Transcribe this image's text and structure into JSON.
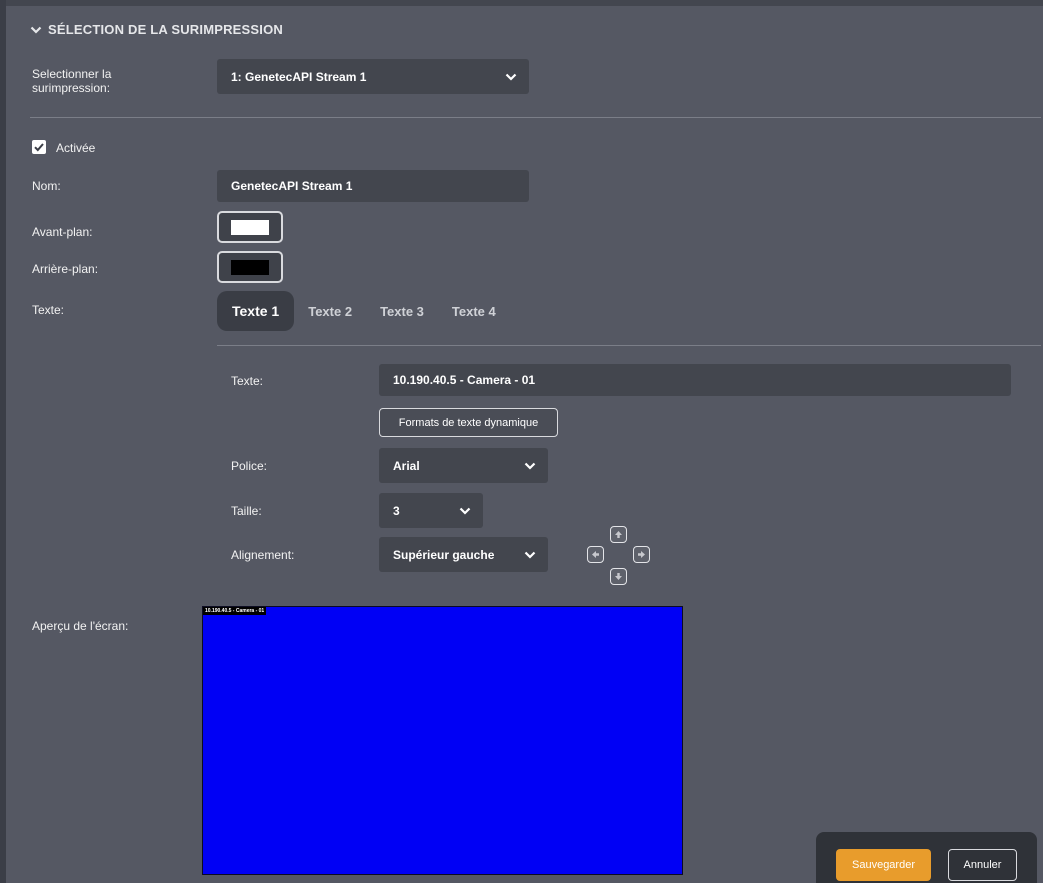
{
  "section": {
    "title": "SÉLECTION DE LA SURIMPRESSION"
  },
  "overlay_select": {
    "label": "Selectionner la surimpression:",
    "value": "1: GenetecAPI Stream 1"
  },
  "enabled": {
    "label": "Activée",
    "checked": true
  },
  "name": {
    "label": "Nom:",
    "value": "GenetecAPI Stream 1"
  },
  "foreground": {
    "label": "Avant-plan:",
    "color": "#ffffff"
  },
  "background": {
    "label": "Arrière-plan:",
    "color": "#000000"
  },
  "text_tabs": {
    "label": "Texte:",
    "tabs": [
      {
        "label": "Texte 1",
        "active": true
      },
      {
        "label": "Texte 2",
        "active": false
      },
      {
        "label": "Texte 3",
        "active": false
      },
      {
        "label": "Texte 4",
        "active": false
      }
    ]
  },
  "text_field": {
    "label": "Texte:",
    "value": "10.190.40.5 - Camera - 01"
  },
  "dynamic_formats_button": "Formats de texte dynamique",
  "font": {
    "label": "Police:",
    "value": "Arial"
  },
  "size": {
    "label": "Taille:",
    "value": "3"
  },
  "alignment": {
    "label": "Alignement:",
    "value": "Supérieur gauche"
  },
  "preview": {
    "label": "Aperçu de l'écran:",
    "overlay_text": "10.190.40.5 - Camera - 01",
    "screen_color": "#0000f5"
  },
  "footer": {
    "save": "Sauvegarder",
    "cancel": "Annuler"
  },
  "colors": {
    "accent": "#e89c2c",
    "panel": "#555863",
    "field": "#43464e"
  }
}
